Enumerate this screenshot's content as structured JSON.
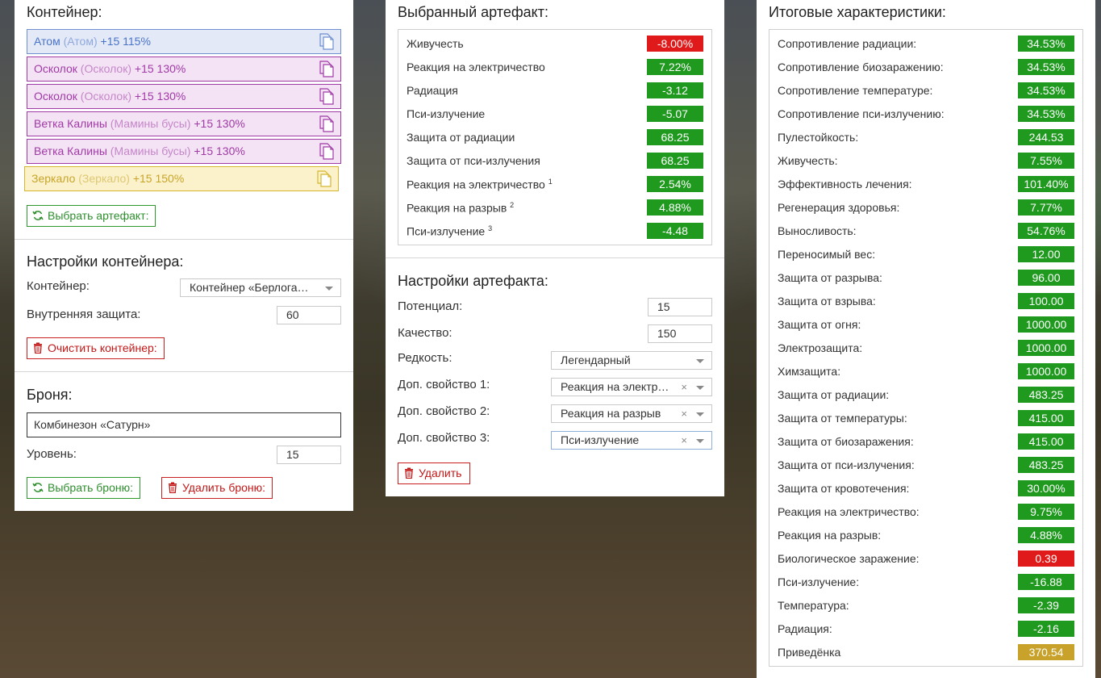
{
  "container": {
    "heading": "Контейнер:",
    "slots": [
      {
        "name": "Атом",
        "sub": "(Атом)",
        "suffix": "+15 115%",
        "kind": "blue"
      },
      {
        "name": "Осколок",
        "sub": "(Осколок)",
        "suffix": "+15 130%",
        "kind": "purple"
      },
      {
        "name": "Осколок",
        "sub": "(Осколок)",
        "suffix": "+15 130%",
        "kind": "purple"
      },
      {
        "name": "Ветка Калины",
        "sub": "(Мамины бусы)",
        "suffix": "+15 130%",
        "kind": "purple"
      },
      {
        "name": "Ветка Калины",
        "sub": "(Мамины бусы)",
        "suffix": "+15 130%",
        "kind": "purple"
      },
      {
        "name": "Зеркало",
        "sub": "(Зеркало)",
        "suffix": "+15 150%",
        "kind": "yellow"
      }
    ],
    "select_artifact_label": "Выбрать артефакт:"
  },
  "container_settings": {
    "heading": "Настройки контейнера:",
    "container_label": "Контейнер:",
    "container_value": "Контейнер «Берлога…",
    "inner_protection_label": "Внутренняя защита:",
    "inner_protection_value": "60",
    "clear_label": "Очистить контейнер:"
  },
  "armor": {
    "heading": "Броня:",
    "name_value": "Комбинезон «Сатурн»",
    "level_label": "Уровень:",
    "level_value": "15",
    "select_label": "Выбрать броню:",
    "delete_label": "Удалить броню:"
  },
  "selected_artifact": {
    "heading": "Выбранный артефакт:",
    "stats": [
      {
        "name": "Живучесть",
        "sup": "",
        "value": "-8.00%",
        "color": "red"
      },
      {
        "name": "Реакция на электричество",
        "sup": "",
        "value": "7.22%",
        "color": "green"
      },
      {
        "name": "Радиация",
        "sup": "",
        "value": "-3.12",
        "color": "green"
      },
      {
        "name": "Пси-излучение",
        "sup": "",
        "value": "-5.07",
        "color": "green"
      },
      {
        "name": "Защита от радиации",
        "sup": "",
        "value": "68.25",
        "color": "green"
      },
      {
        "name": "Защита от пси-излучения",
        "sup": "",
        "value": "68.25",
        "color": "green"
      },
      {
        "name": "Реакция на электричество",
        "sup": "1",
        "value": "2.54%",
        "color": "green"
      },
      {
        "name": "Реакция на разрыв",
        "sup": "2",
        "value": "4.88%",
        "color": "green"
      },
      {
        "name": "Пси-излучение",
        "sup": "3",
        "value": "-4.48",
        "color": "green"
      }
    ]
  },
  "artifact_settings": {
    "heading": "Настройки артефакта:",
    "potential_label": "Потенциал:",
    "potential_value": "15",
    "quality_label": "Качество:",
    "quality_value": "150",
    "rarity_label": "Редкость:",
    "rarity_value": "Легендарный",
    "prop1_label": "Доп. свойство 1:",
    "prop1_value": "Реакция на электр…",
    "prop2_label": "Доп. свойство 2:",
    "prop2_value": "Реакция на разрыв",
    "prop3_label": "Доп. свойство 3:",
    "prop3_value": "Пси-излучение",
    "clear_glyph": "×",
    "delete_label": "Удалить"
  },
  "totals": {
    "heading": "Итоговые характеристики:",
    "stats": [
      {
        "name": "Сопротивление радиации:",
        "value": "34.53%",
        "color": "green"
      },
      {
        "name": "Сопротивление биозаражению:",
        "value": "34.53%",
        "color": "green"
      },
      {
        "name": "Сопротивление температуре:",
        "value": "34.53%",
        "color": "green"
      },
      {
        "name": "Сопротивление пси-излучению:",
        "value": "34.53%",
        "color": "green"
      },
      {
        "name": "Пулестойкость:",
        "value": "244.53",
        "color": "green"
      },
      {
        "name": "Живучесть:",
        "value": "7.55%",
        "color": "green"
      },
      {
        "name": "Эффективность лечения:",
        "value": "101.40%",
        "color": "green"
      },
      {
        "name": "Регенерация здоровья:",
        "value": "7.77%",
        "color": "green"
      },
      {
        "name": "Выносливость:",
        "value": "54.76%",
        "color": "green"
      },
      {
        "name": "Переносимый вес:",
        "value": "12.00",
        "color": "green"
      },
      {
        "name": "Защита от разрыва:",
        "value": "96.00",
        "color": "green"
      },
      {
        "name": "Защита от взрыва:",
        "value": "100.00",
        "color": "green"
      },
      {
        "name": "Защита от огня:",
        "value": "1000.00",
        "color": "green"
      },
      {
        "name": "Электрозащита:",
        "value": "1000.00",
        "color": "green"
      },
      {
        "name": "Химзащита:",
        "value": "1000.00",
        "color": "green"
      },
      {
        "name": "Защита от радиации:",
        "value": "483.25",
        "color": "green"
      },
      {
        "name": "Защита от температуры:",
        "value": "415.00",
        "color": "green"
      },
      {
        "name": "Защита от биозаражения:",
        "value": "415.00",
        "color": "green"
      },
      {
        "name": "Защита от пси-излучения:",
        "value": "483.25",
        "color": "green"
      },
      {
        "name": "Защита от кровотечения:",
        "value": "30.00%",
        "color": "green"
      },
      {
        "name": "Реакция на электричество:",
        "value": "9.75%",
        "color": "green"
      },
      {
        "name": "Реакция на разрыв:",
        "value": "4.88%",
        "color": "green"
      },
      {
        "name": "Биологическое заражение:",
        "value": "0.39",
        "color": "red"
      },
      {
        "name": "Пси-излучение:",
        "value": "-16.88",
        "color": "green"
      },
      {
        "name": "Температура:",
        "value": "-2.39",
        "color": "green"
      },
      {
        "name": "Радиация:",
        "value": "-2.16",
        "color": "green"
      },
      {
        "name": "Приведёнка",
        "value": "370.54",
        "color": "gold"
      }
    ]
  },
  "colors": {
    "green": "#1f9a1f",
    "red": "#e01a1a",
    "gold": "#c8a22a",
    "slot_blue": "#4a74c8",
    "slot_purple": "#a03aa6",
    "slot_yellow": "#c8a52a"
  }
}
